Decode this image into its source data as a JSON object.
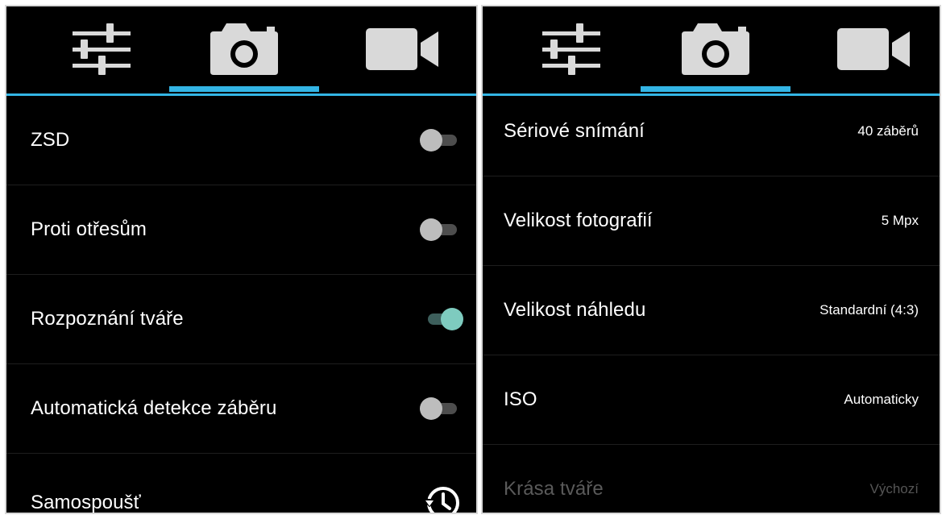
{
  "left_panel": {
    "tabs": [
      {
        "icon": "settings-sliders-icon"
      },
      {
        "icon": "camera-icon",
        "selected": true
      },
      {
        "icon": "video-camera-icon"
      }
    ],
    "settings": [
      {
        "label": "ZSD",
        "control": "switch",
        "checked": false
      },
      {
        "label": "Proti otřesům",
        "control": "switch",
        "checked": false
      },
      {
        "label": "Rozpoznání tváře",
        "control": "switch",
        "checked": true
      },
      {
        "label": "Automatická detekce záběru",
        "control": "switch",
        "checked": false
      },
      {
        "label": "Samospoušť",
        "control": "timer-icon"
      }
    ]
  },
  "right_panel": {
    "tabs": [
      {
        "icon": "settings-sliders-icon"
      },
      {
        "icon": "camera-icon",
        "selected": true
      },
      {
        "icon": "video-camera-icon"
      }
    ],
    "settings": [
      {
        "label": "Sériové snímání",
        "value": "40 záběrů"
      },
      {
        "label": "Velikost fotografií",
        "value": "5 Mpx"
      },
      {
        "label": "Velikost náhledu",
        "value": "Standardní (4:3)"
      },
      {
        "label": "ISO",
        "value": "Automaticky"
      },
      {
        "label": "Krása tváře",
        "value": "Výchozí",
        "disabled": true
      }
    ]
  },
  "colors": {
    "accent": "#33b5e5",
    "switch_on": "#7ecbbf",
    "switch_off": "#bdbdbd",
    "background": "#000000",
    "icon": "#d9d9d9"
  }
}
